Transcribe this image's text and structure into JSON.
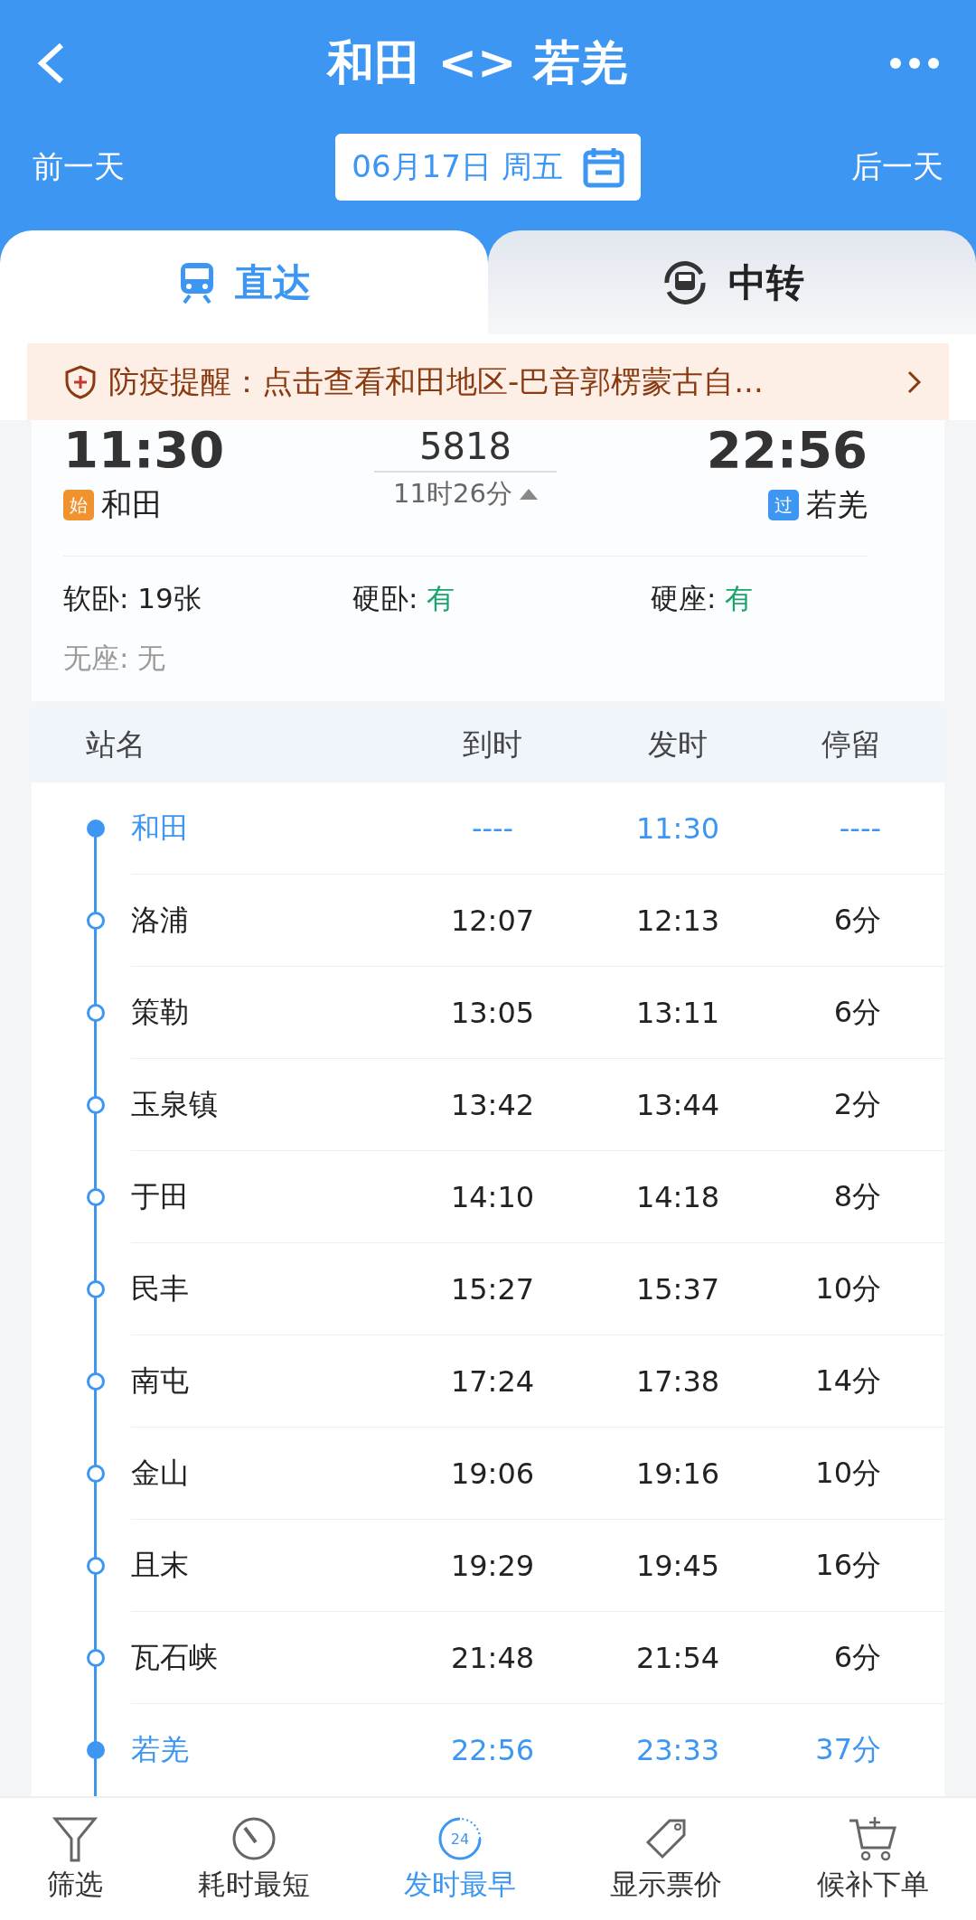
{
  "header": {
    "title": "和田 <> 若羌",
    "prev_day": "前一天",
    "date": "06月17日 周五",
    "next_day": "后一天"
  },
  "tabs": [
    {
      "label": "直达",
      "kind": "direct",
      "selected": true
    },
    {
      "label": "中转",
      "kind": "transfer",
      "selected": false
    }
  ],
  "notice": {
    "text": "防疫提醒：点击查看和田地区-巴音郭楞蒙古自..."
  },
  "train": {
    "depart_time": "11:30",
    "depart_badge": "始",
    "depart_station": "和田",
    "number": "5818",
    "duration": "11时26分",
    "arrive_time": "22:56",
    "arrive_badge": "过",
    "arrive_station": "若羌",
    "seats": [
      {
        "label": "软卧: ",
        "value": "19张",
        "kind": "count"
      },
      {
        "label": "硬卧: ",
        "value": "有",
        "kind": "available"
      },
      {
        "label": "硬座: ",
        "value": "有",
        "kind": "available"
      },
      {
        "label": "无座: ",
        "value": "无",
        "kind": "none"
      }
    ]
  },
  "table": {
    "columns": [
      "站名",
      "到时",
      "发时",
      "停留"
    ],
    "rows": [
      {
        "station": "和田",
        "arrive": "----",
        "depart": "11:30",
        "stop": "----",
        "kind": "endpoint"
      },
      {
        "station": "洛浦",
        "arrive": "12:07",
        "depart": "12:13",
        "stop": "6分",
        "kind": "stop"
      },
      {
        "station": "策勒",
        "arrive": "13:05",
        "depart": "13:11",
        "stop": "6分",
        "kind": "stop"
      },
      {
        "station": "玉泉镇",
        "arrive": "13:42",
        "depart": "13:44",
        "stop": "2分",
        "kind": "stop"
      },
      {
        "station": "于田",
        "arrive": "14:10",
        "depart": "14:18",
        "stop": "8分",
        "kind": "stop"
      },
      {
        "station": "民丰",
        "arrive": "15:27",
        "depart": "15:37",
        "stop": "10分",
        "kind": "stop"
      },
      {
        "station": "南屯",
        "arrive": "17:24",
        "depart": "17:38",
        "stop": "14分",
        "kind": "stop"
      },
      {
        "station": "金山",
        "arrive": "19:06",
        "depart": "19:16",
        "stop": "10分",
        "kind": "stop"
      },
      {
        "station": "且末",
        "arrive": "19:29",
        "depart": "19:45",
        "stop": "16分",
        "kind": "stop"
      },
      {
        "station": "瓦石峡",
        "arrive": "21:48",
        "depart": "21:54",
        "stop": "6分",
        "kind": "stop"
      },
      {
        "station": "若羌",
        "arrive": "22:56",
        "depart": "23:33",
        "stop": "37分",
        "kind": "endpoint"
      }
    ]
  },
  "toolbar": [
    {
      "label": "筛选",
      "kind": "filter",
      "selected": false
    },
    {
      "label": "耗时最短",
      "kind": "timer",
      "selected": false
    },
    {
      "label": "发时最早",
      "kind": "clock",
      "badge": "24",
      "selected": true
    },
    {
      "label": "显示票价",
      "kind": "tag",
      "selected": false
    },
    {
      "label": "候补下单",
      "kind": "cart",
      "selected": false
    }
  ]
}
